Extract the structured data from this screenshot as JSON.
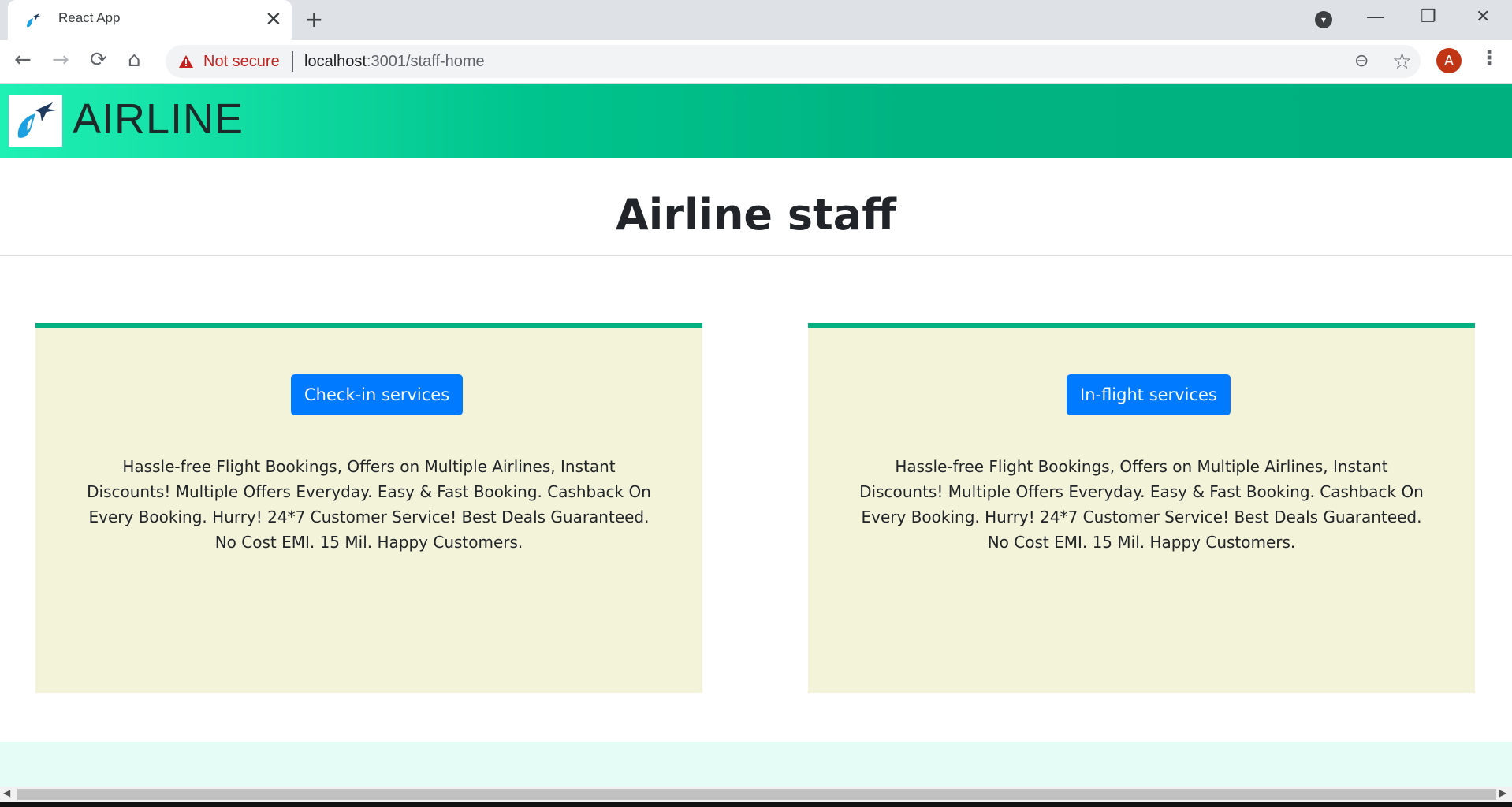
{
  "browser": {
    "tab_title": "React App",
    "tab_close": "✕",
    "new_tab": "+",
    "minimize": "—",
    "restore": "❐",
    "close": "✕",
    "back": "←",
    "forward": "→",
    "reload": "⟳",
    "home": "⌂",
    "security_label": "Not secure",
    "url_host": "localhost",
    "url_rest": ":3001/staff-home",
    "zoom": "⊖",
    "star": "☆",
    "avatar_letter": "A",
    "menu": "⋮",
    "profile_drop": "▾"
  },
  "header": {
    "brand": "AIRLINE"
  },
  "main": {
    "title": "Airline staff",
    "cards": [
      {
        "button_label": "Check-in services",
        "description": "Hassle-free Flight Bookings, Offers on Multiple Airlines, Instant Discounts! Multiple Offers Everyday. Easy & Fast Booking. Cashback On Every Booking. Hurry! 24*7 Customer Service! Best Deals Guaranteed. No Cost EMI. 15 Mil. Happy Customers."
      },
      {
        "button_label": "In-flight services",
        "description": "Hassle-free Flight Bookings, Offers on Multiple Airlines, Instant Discounts! Multiple Offers Everyday. Easy & Fast Booking. Cashback On Every Booking. Hurry! 24*7 Customer Service! Best Deals Guaranteed. No Cost EMI. 15 Mil. Happy Customers."
      }
    ]
  },
  "colors": {
    "accent": "#00b07e",
    "button": "#007bff",
    "card_bg": "#f3f3da",
    "security_warning": "#c5221f"
  }
}
